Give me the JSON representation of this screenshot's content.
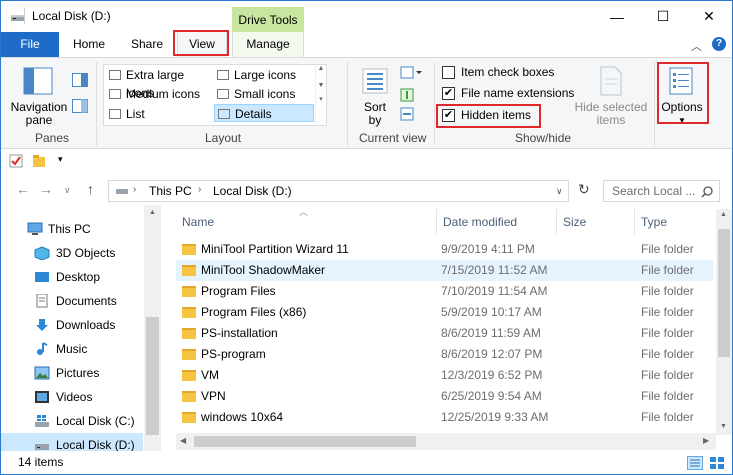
{
  "window": {
    "title": "Local Disk (D:)",
    "context_group": "Drive Tools",
    "minimize_glyph": "—",
    "maximize_glyph": "☐",
    "close_glyph": "✕"
  },
  "tabs": {
    "file": "File",
    "home": "Home",
    "share": "Share",
    "view": "View",
    "manage": "Manage"
  },
  "ribbon": {
    "panes": {
      "navigation_pane": "Navigation",
      "navigation_pane_2": "pane",
      "group": "Panes"
    },
    "layout": {
      "group": "Layout",
      "items": [
        "Extra large icons",
        "Large icons",
        "Medium icons",
        "Small icons",
        "List",
        "Details"
      ],
      "selected": "Details"
    },
    "current_view": {
      "sort_by": "Sort",
      "sort_by_2": "by",
      "group": "Current view"
    },
    "show_hide": {
      "group": "Show/hide",
      "item_check_boxes": "Item check boxes",
      "file_name_extensions": "File name extensions",
      "hidden_items": "Hidden items",
      "hide_selected_items": "Hide selected",
      "hide_selected_items_2": "items"
    },
    "options": "Options"
  },
  "address": {
    "path": [
      "This PC",
      "Local Disk (D:)"
    ],
    "search_placeholder": "Search Local ..."
  },
  "nav_pane": {
    "items": [
      "This PC",
      "3D Objects",
      "Desktop",
      "Documents",
      "Downloads",
      "Music",
      "Pictures",
      "Videos",
      "Local Disk (C:)",
      "Local Disk (D:)"
    ],
    "selected": "Local Disk (D:)"
  },
  "file_list": {
    "columns": {
      "name": "Name",
      "date": "Date modified",
      "size": "Size",
      "type": "Type"
    },
    "rows": [
      {
        "name": "MiniTool Partition Wizard 11",
        "date": "9/9/2019 4:11 PM",
        "type": "File folder"
      },
      {
        "name": "MiniTool ShadowMaker",
        "date": "7/15/2019 11:52 AM",
        "type": "File folder"
      },
      {
        "name": "Program Files",
        "date": "7/10/2019 11:54 AM",
        "type": "File folder"
      },
      {
        "name": "Program Files (x86)",
        "date": "5/9/2019 10:17 AM",
        "type": "File folder"
      },
      {
        "name": "PS-installation",
        "date": "8/6/2019 11:59 AM",
        "type": "File folder"
      },
      {
        "name": "PS-program",
        "date": "8/6/2019 12:07 PM",
        "type": "File folder"
      },
      {
        "name": "VM",
        "date": "12/3/2019 6:52 PM",
        "type": "File folder"
      },
      {
        "name": "VPN",
        "date": "6/25/2019 9:54 AM",
        "type": "File folder"
      },
      {
        "name": "windows 10x64",
        "date": "12/25/2019 9:33 AM",
        "type": "File folder"
      }
    ]
  },
  "status": {
    "item_count": "14 items"
  },
  "colors": {
    "accent": "#1e6bc8",
    "highlight_box": "#e0272a",
    "context_tab": "#c8e6a0"
  }
}
